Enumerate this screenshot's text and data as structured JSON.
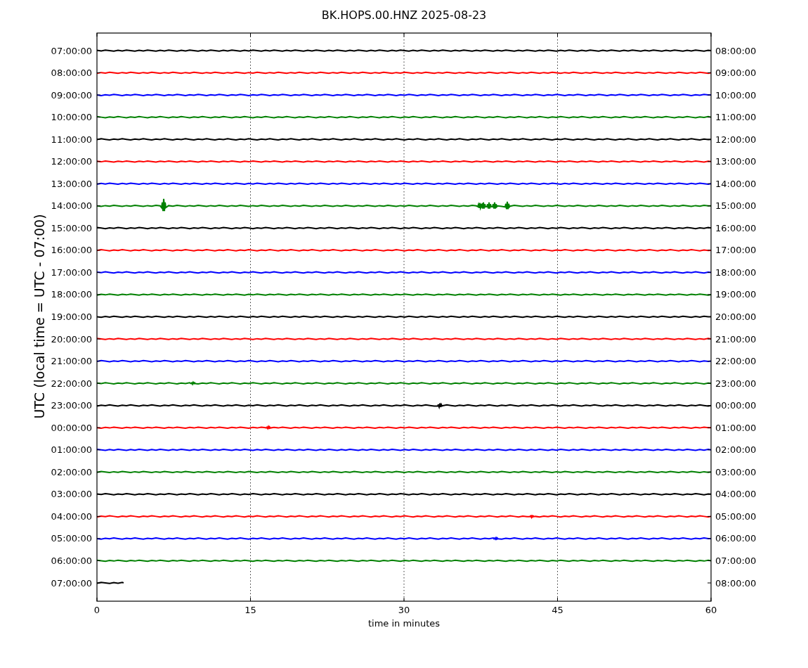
{
  "title": "BK.HOPS.00.HNZ 2025-08-23",
  "ylabel": "UTC (local time = UTC - 07:00)",
  "xlabel": "time in minutes",
  "xticks": [
    "0",
    "15",
    "30",
    "45",
    "60"
  ],
  "traces": [
    {
      "left": "07:00:00",
      "right": "08:00:00",
      "color": "#000000",
      "kind": "full"
    },
    {
      "left": "08:00:00",
      "right": "09:00:00",
      "color": "#ff0000",
      "kind": "full"
    },
    {
      "left": "09:00:00",
      "right": "10:00:00",
      "color": "#0000ff",
      "kind": "full"
    },
    {
      "left": "10:00:00",
      "right": "11:00:00",
      "color": "#008000",
      "kind": "full"
    },
    {
      "left": "11:00:00",
      "right": "12:00:00",
      "color": "#000000",
      "kind": "full"
    },
    {
      "left": "12:00:00",
      "right": "13:00:00",
      "color": "#ff0000",
      "kind": "full"
    },
    {
      "left": "13:00:00",
      "right": "14:00:00",
      "color": "#0000ff",
      "kind": "full"
    },
    {
      "left": "14:00:00",
      "right": "15:00:00",
      "color": "#008000",
      "kind": "full"
    },
    {
      "left": "15:00:00",
      "right": "16:00:00",
      "color": "#000000",
      "kind": "full"
    },
    {
      "left": "16:00:00",
      "right": "17:00:00",
      "color": "#ff0000",
      "kind": "full"
    },
    {
      "left": "17:00:00",
      "right": "18:00:00",
      "color": "#0000ff",
      "kind": "full"
    },
    {
      "left": "18:00:00",
      "right": "19:00:00",
      "color": "#008000",
      "kind": "full"
    },
    {
      "left": "19:00:00",
      "right": "20:00:00",
      "color": "#000000",
      "kind": "full"
    },
    {
      "left": "20:00:00",
      "right": "21:00:00",
      "color": "#ff0000",
      "kind": "full"
    },
    {
      "left": "21:00:00",
      "right": "22:00:00",
      "color": "#0000ff",
      "kind": "full"
    },
    {
      "left": "22:00:00",
      "right": "23:00:00",
      "color": "#008000",
      "kind": "full"
    },
    {
      "left": "23:00:00",
      "right": "00:00:00",
      "color": "#000000",
      "kind": "full"
    },
    {
      "left": "00:00:00",
      "right": "01:00:00",
      "color": "#ff0000",
      "kind": "full"
    },
    {
      "left": "01:00:00",
      "right": "02:00:00",
      "color": "#0000ff",
      "kind": "full"
    },
    {
      "left": "02:00:00",
      "right": "03:00:00",
      "color": "#008000",
      "kind": "full"
    },
    {
      "left": "03:00:00",
      "right": "04:00:00",
      "color": "#000000",
      "kind": "full"
    },
    {
      "left": "04:00:00",
      "right": "05:00:00",
      "color": "#ff0000",
      "kind": "full"
    },
    {
      "left": "05:00:00",
      "right": "06:00:00",
      "color": "#0000ff",
      "kind": "full"
    },
    {
      "left": "06:00:00",
      "right": "07:00:00",
      "color": "#008000",
      "kind": "full"
    },
    {
      "left": "07:00:00",
      "right": "08:00:00",
      "color": "#000000",
      "kind": "partial"
    }
  ]
}
